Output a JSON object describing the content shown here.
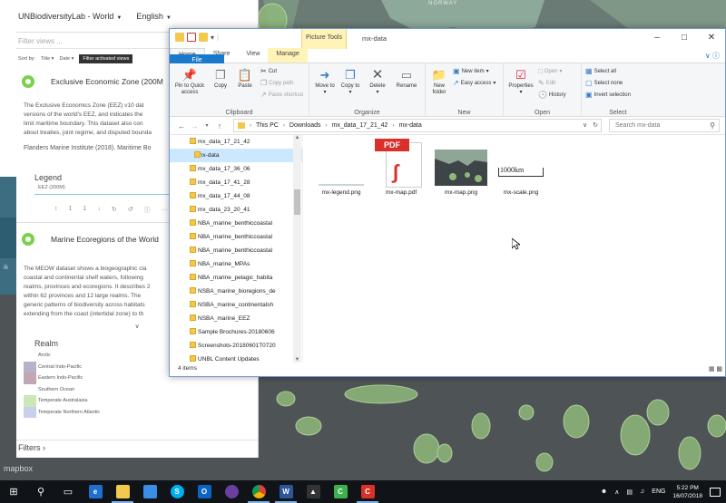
{
  "map": {
    "country_label": "NORWAY",
    "attribution": "mapbox",
    "zoom_text": "ik"
  },
  "webapp": {
    "app_name": "UNBiodiversityLab - World",
    "language": "English",
    "filter_placeholder": "Filter views ...",
    "sort_by": "Sort by:",
    "sort_title": "Title",
    "sort_date": "Date",
    "filter_activated": "Filter activated views",
    "layers": [
      {
        "title": "Exclusive Economic Zone (200M",
        "paragraph": [
          "The Exclusive Economics Zone (EEZ) v10 dat",
          "versions of the world's EEZ, and indicates the",
          "limit maritime boundary. This dataset also con",
          "about treaties, joint regime, and disputed bounda"
        ],
        "citation": "Flanders Marine Institute (2018). Maritime Bo"
      },
      {
        "title": "Marine Ecoregions of the World",
        "paragraph": [
          "The MEOW dataset shows a biogeographic cla",
          "coastal and continental shelf waters, following",
          "realms, provinces and ecoregions. It describes 2",
          "within 62 provinces and 12 large realms. The",
          "generic patterns of biodiversity across habitats",
          "extending from the coast (intertidal zone) to th"
        ]
      }
    ],
    "legend_title": "Legend",
    "legend_item": "EEZ (200M)",
    "tools": [
      "↕",
      "1",
      "1",
      "↓",
      "↻",
      "↺",
      "ⓘ",
      "…"
    ],
    "chevron": "∨",
    "realm_title": "Realm",
    "realms": [
      {
        "name": "Arctic",
        "color": "#ffffff"
      },
      {
        "name": "Central Indo-Pacific",
        "color": "#b6b2c9"
      },
      {
        "name": "Eastern Indo-Pacific",
        "color": "#c3a6b4"
      },
      {
        "name": "Southern Ocean",
        "color": "#ffffff"
      },
      {
        "name": "Temperate Australasia",
        "color": "#cbe7b8"
      },
      {
        "name": "Temperate Northern Atlantic",
        "color": "#c9d0ea"
      }
    ],
    "filters_label": "Filters ›"
  },
  "explorer": {
    "picture_tools": "Picture Tools",
    "window_title": "mx-data",
    "tabs": [
      "File",
      "Home",
      "Share",
      "View",
      "Manage"
    ],
    "clipboard": {
      "label": "Clipboard",
      "pin": "Pin to Quick access",
      "copy": "Copy",
      "paste": "Paste",
      "cut": "Cut",
      "copy_path": "Copy path",
      "paste_shortcut": "Paste shortcut"
    },
    "organize": {
      "label": "Organize",
      "move_to": "Move to",
      "copy_to": "Copy to",
      "delete": "Delete",
      "rename": "Rename"
    },
    "new": {
      "label": "New",
      "new_folder": "New folder",
      "new_item": "New item",
      "easy_access": "Easy access"
    },
    "open": {
      "label": "Open",
      "properties": "Properties",
      "open": "Open",
      "edit": "Edit",
      "history": "History"
    },
    "select": {
      "label": "Select",
      "select_all": "Select all",
      "select_none": "Select none",
      "invert": "Invert selection"
    },
    "breadcrumb": [
      "This PC",
      "Downloads",
      "mx_data_17_21_42",
      "mx-data"
    ],
    "search_placeholder": "Search mx-data",
    "nav_items": [
      "mx_data_17_21_42",
      "mx-data",
      "mx_data_17_36_06",
      "mx_data_17_41_28",
      "mx_data_17_44_08",
      "mx_data_23_20_41",
      "NBA_marine_benthiccoastal",
      "NBA_marine_benthiccoastal",
      "NBA_marine_benthiccoastal",
      "NBA_marine_MPAs",
      "NBA_marine_pelagic_habita",
      "NSBA_marine_bioregions_de",
      "NSBA_marine_continentalsh",
      "NSBA_marine_EEZ",
      "Sample Brochures-20180606",
      "Screenshots-20180601T0720",
      "UNBL Content Updates"
    ],
    "files": [
      "mx-legend.png",
      "mx-map.pdf",
      "mx-map.png",
      "mx-scale.png"
    ],
    "pdf_badge": "PDF",
    "scale_text": "1000km",
    "status": "4 items"
  },
  "taskbar": {
    "language": "ENG",
    "time": "5:22 PM",
    "date": "16/07/2018"
  }
}
